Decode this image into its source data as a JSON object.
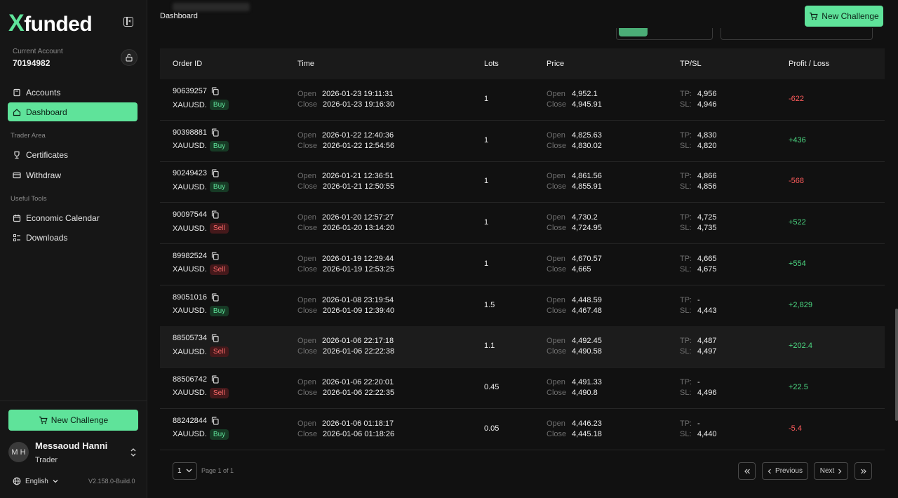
{
  "brand": {
    "logo_x": "X",
    "logo_rest": "funded"
  },
  "account": {
    "label": "Current Account",
    "number": "70194982"
  },
  "nav": {
    "accounts": "Accounts",
    "dashboard": "Dashboard",
    "trader_area": "Trader Area",
    "certificates": "Certificates",
    "withdraw": "Withdraw",
    "useful_tools": "Useful Tools",
    "economic_calendar": "Economic Calendar",
    "downloads": "Downloads"
  },
  "sidebar_cta": "New Challenge",
  "user": {
    "initials": "M H",
    "name": "Messaoud Hanni",
    "role": "Trader"
  },
  "language": "English",
  "version": "V2.158.0-Build.0",
  "header": {
    "breadcrumb": "Dashboard",
    "new_challenge": "New Challenge"
  },
  "table": {
    "headers": {
      "order_id": "Order ID",
      "time": "Time",
      "lots": "Lots",
      "price": "Price",
      "tpsl": "TP/SL",
      "pl": "Profit / Loss"
    },
    "labels": {
      "open": "Open",
      "close": "Close",
      "tp": "TP:",
      "sl": "SL:"
    },
    "rows": [
      {
        "id": "90639257",
        "symbol": "XAUUSD.",
        "side": "Buy",
        "open_time": "2026-01-23 19:11:31",
        "close_time": "2026-01-23 19:16:30",
        "lots": "1",
        "open_price": "4,952.1",
        "close_price": "4,945.91",
        "tp": "4,956",
        "sl": "4,946",
        "pl": "-622"
      },
      {
        "id": "90398881",
        "symbol": "XAUUSD.",
        "side": "Buy",
        "open_time": "2026-01-22 12:40:36",
        "close_time": "2026-01-22 12:54:56",
        "lots": "1",
        "open_price": "4,825.63",
        "close_price": "4,830.02",
        "tp": "4,830",
        "sl": "4,820",
        "pl": "+436"
      },
      {
        "id": "90249423",
        "symbol": "XAUUSD.",
        "side": "Buy",
        "open_time": "2026-01-21 12:36:51",
        "close_time": "2026-01-21 12:50:55",
        "lots": "1",
        "open_price": "4,861.56",
        "close_price": "4,855.91",
        "tp": "4,866",
        "sl": "4,856",
        "pl": "-568"
      },
      {
        "id": "90097544",
        "symbol": "XAUUSD.",
        "side": "Sell",
        "open_time": "2026-01-20 12:57:27",
        "close_time": "2026-01-20 13:14:20",
        "lots": "1",
        "open_price": "4,730.2",
        "close_price": "4,724.95",
        "tp": "4,725",
        "sl": "4,735",
        "pl": "+522"
      },
      {
        "id": "89982524",
        "symbol": "XAUUSD.",
        "side": "Sell",
        "open_time": "2026-01-19 12:29:44",
        "close_time": "2026-01-19 12:53:25",
        "lots": "1",
        "open_price": "4,670.57",
        "close_price": "4,665",
        "tp": "4,665",
        "sl": "4,675",
        "pl": "+554"
      },
      {
        "id": "89051016",
        "symbol": "XAUUSD.",
        "side": "Buy",
        "open_time": "2026-01-08 23:19:54",
        "close_time": "2026-01-09 12:39:40",
        "lots": "1.5",
        "open_price": "4,448.59",
        "close_price": "4,467.48",
        "tp": "-",
        "sl": "4,443",
        "pl": "+2,829"
      },
      {
        "id": "88505734",
        "symbol": "XAUUSD.",
        "side": "Sell",
        "open_time": "2026-01-06 22:17:18",
        "close_time": "2026-01-06 22:22:38",
        "lots": "1.1",
        "open_price": "4,492.45",
        "close_price": "4,490.58",
        "tp": "4,487",
        "sl": "4,497",
        "pl": "+202.4"
      },
      {
        "id": "88506742",
        "symbol": "XAUUSD.",
        "side": "Sell",
        "open_time": "2026-01-06 22:20:01",
        "close_time": "2026-01-06 22:22:35",
        "lots": "0.45",
        "open_price": "4,491.33",
        "close_price": "4,490.8",
        "tp": "-",
        "sl": "4,496",
        "pl": "+22.5"
      },
      {
        "id": "88242844",
        "symbol": "XAUUSD.",
        "side": "Buy",
        "open_time": "2026-01-06 01:18:17",
        "close_time": "2026-01-06 01:18:26",
        "lots": "0.05",
        "open_price": "4,446.23",
        "close_price": "4,445.18",
        "tp": "-",
        "sl": "4,440",
        "pl": "-5.4"
      }
    ]
  },
  "pagination": {
    "page_size": "1",
    "info": "Page 1 of 1",
    "previous": "Previous",
    "next": "Next"
  },
  "colors": {
    "accent": "#5fe39a",
    "profit": "#4cd882",
    "loss": "#ff5c5c",
    "background": "#111111",
    "sidebar": "#161616"
  }
}
